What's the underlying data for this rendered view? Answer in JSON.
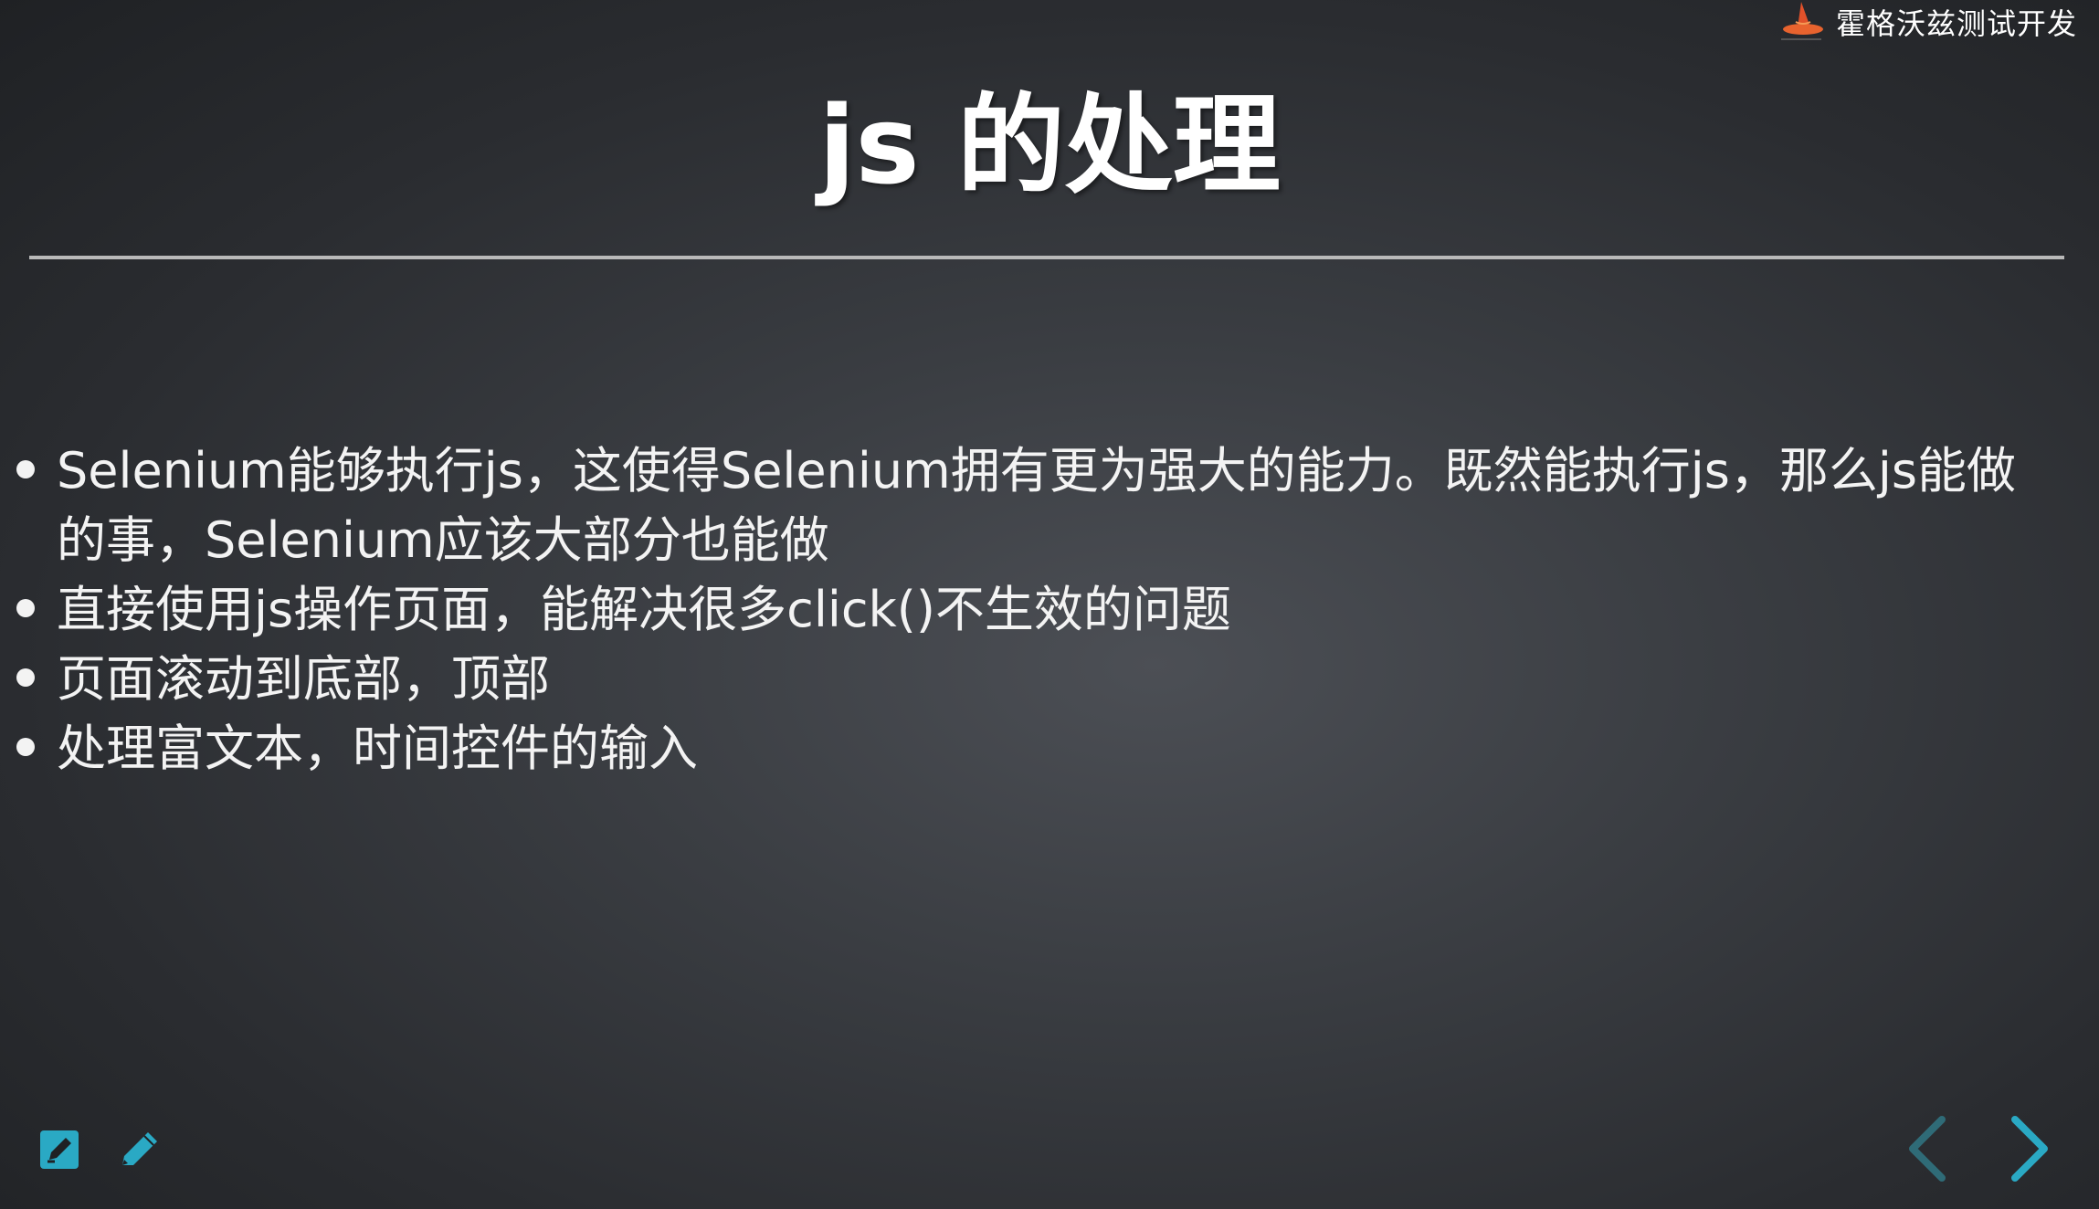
{
  "brand": {
    "name": "霍格沃兹测试开发"
  },
  "slide": {
    "title": "js 的处理",
    "bullets": [
      {
        "line1": "Selenium能够执行js，这使得Selenium拥有更为强大的能力。既然能执行js，那么js能做",
        "line2": "的事，Selenium应该大部分也能做"
      },
      {
        "line1": "直接使用js操作页面，能解决很多click()不生效的问题"
      },
      {
        "line1": "页面滚动到底部，顶部"
      },
      {
        "line1": "处理富文本，时间控件的输入"
      }
    ]
  },
  "controls": {
    "left_icons": [
      "edit-note-icon",
      "pencil-icon"
    ],
    "nav_icons": [
      "chevron-left-icon",
      "chevron-right-icon"
    ],
    "accent_color": "#2aa9c4",
    "disabled_color": "#2f6b77"
  }
}
